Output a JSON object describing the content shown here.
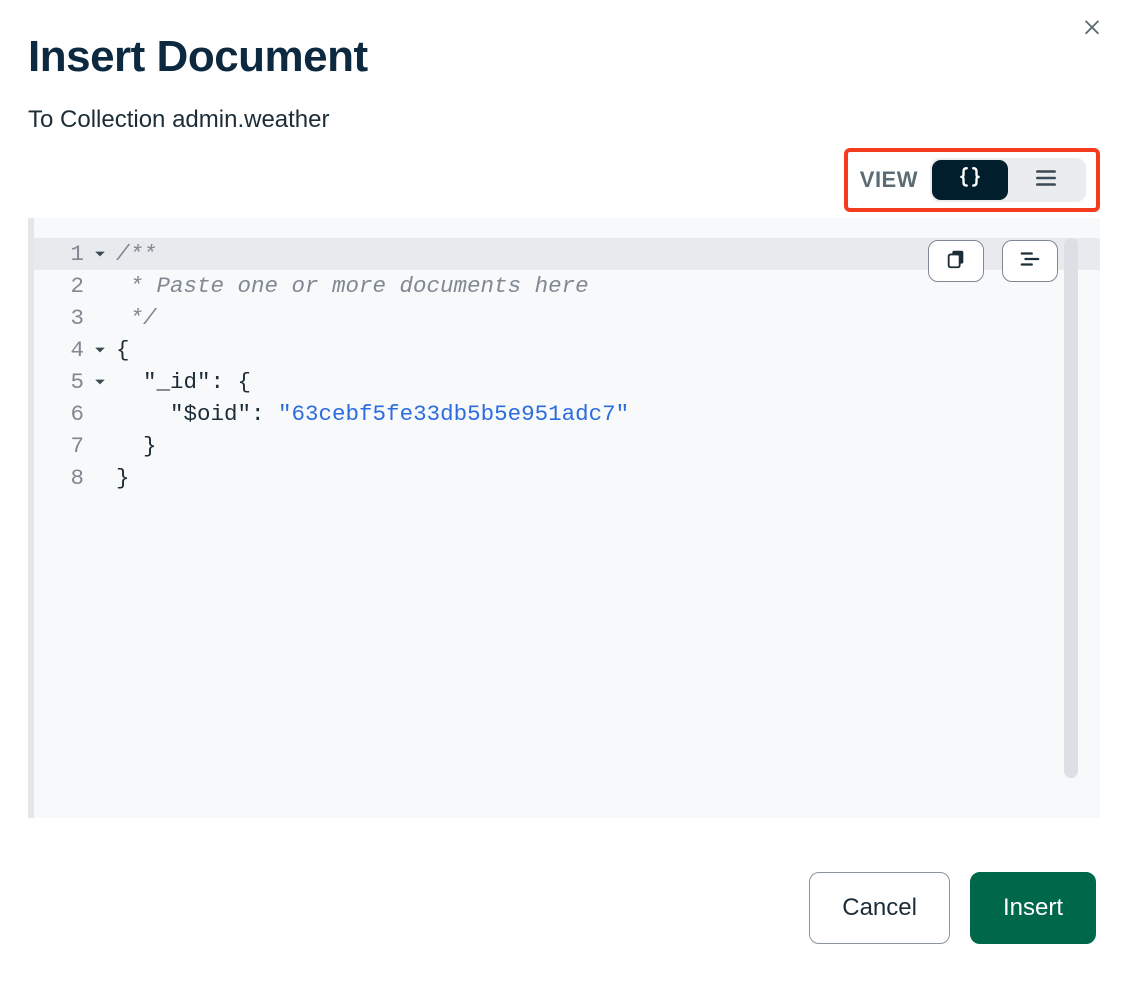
{
  "dialog": {
    "title": "Insert Document",
    "subtitle": "To Collection admin.weather"
  },
  "view": {
    "label": "VIEW",
    "mode_json_active": true
  },
  "editor": {
    "lines": [
      {
        "n": 1,
        "fold": true,
        "type": "comment",
        "text": "/**"
      },
      {
        "n": 2,
        "fold": false,
        "type": "comment",
        "text": " * Paste one or more documents here"
      },
      {
        "n": 3,
        "fold": false,
        "type": "comment",
        "text": " */"
      },
      {
        "n": 4,
        "fold": true,
        "type": "brace",
        "text": "{"
      },
      {
        "n": 5,
        "fold": true,
        "type": "kv",
        "indent": 1,
        "key": "\"_id\"",
        "after": ": {"
      },
      {
        "n": 6,
        "fold": false,
        "type": "kvstr",
        "indent": 2,
        "key": "\"$oid\"",
        "after": ": ",
        "value": "\"63cebf5fe33db5b5e951adc7\""
      },
      {
        "n": 7,
        "fold": false,
        "type": "brace",
        "indent": 1,
        "text": "}"
      },
      {
        "n": 8,
        "fold": false,
        "type": "brace",
        "indent": 0,
        "text": "}"
      }
    ]
  },
  "footer": {
    "cancel": "Cancel",
    "insert": "Insert"
  }
}
